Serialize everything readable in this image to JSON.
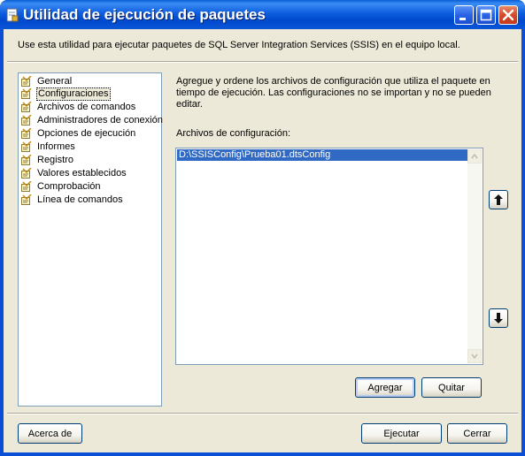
{
  "window": {
    "title": "Utilidad de ejecución de paquetes",
    "description": "Use esta utilidad para ejecutar paquetes de SQL Server Integration Services (SSIS) en el equipo local."
  },
  "nav": {
    "items": [
      {
        "label": "General",
        "selected": false
      },
      {
        "label": "Configuraciones",
        "selected": true
      },
      {
        "label": "Archivos de comandos",
        "selected": false
      },
      {
        "label": "Administradores de conexión",
        "selected": false
      },
      {
        "label": "Opciones de ejecución",
        "selected": false
      },
      {
        "label": "Informes",
        "selected": false
      },
      {
        "label": "Registro",
        "selected": false
      },
      {
        "label": "Valores establecidos",
        "selected": false
      },
      {
        "label": "Comprobación",
        "selected": false
      },
      {
        "label": "Línea de comandos",
        "selected": false
      }
    ]
  },
  "main": {
    "info_text": "Agregue y ordene los archivos de configuración que utiliza el paquete en tiempo de ejecución. Las configuraciones no se importan y no se pueden editar.",
    "files_label": "Archivos de configuración:",
    "files": [
      "D:\\SSISConfig\\Prueba01.dtsConfig"
    ],
    "add_label": "Agregar",
    "remove_label": "Quitar",
    "move_up_icon": "arrow-up-icon",
    "move_down_icon": "arrow-down-icon"
  },
  "footer": {
    "about_label": "Acerca de",
    "execute_label": "Ejecutar",
    "close_label": "Cerrar"
  },
  "colors": {
    "title_bar": "#0a5fd8",
    "selection": "#316ac5",
    "dialog_bg": "#ece9d8"
  }
}
